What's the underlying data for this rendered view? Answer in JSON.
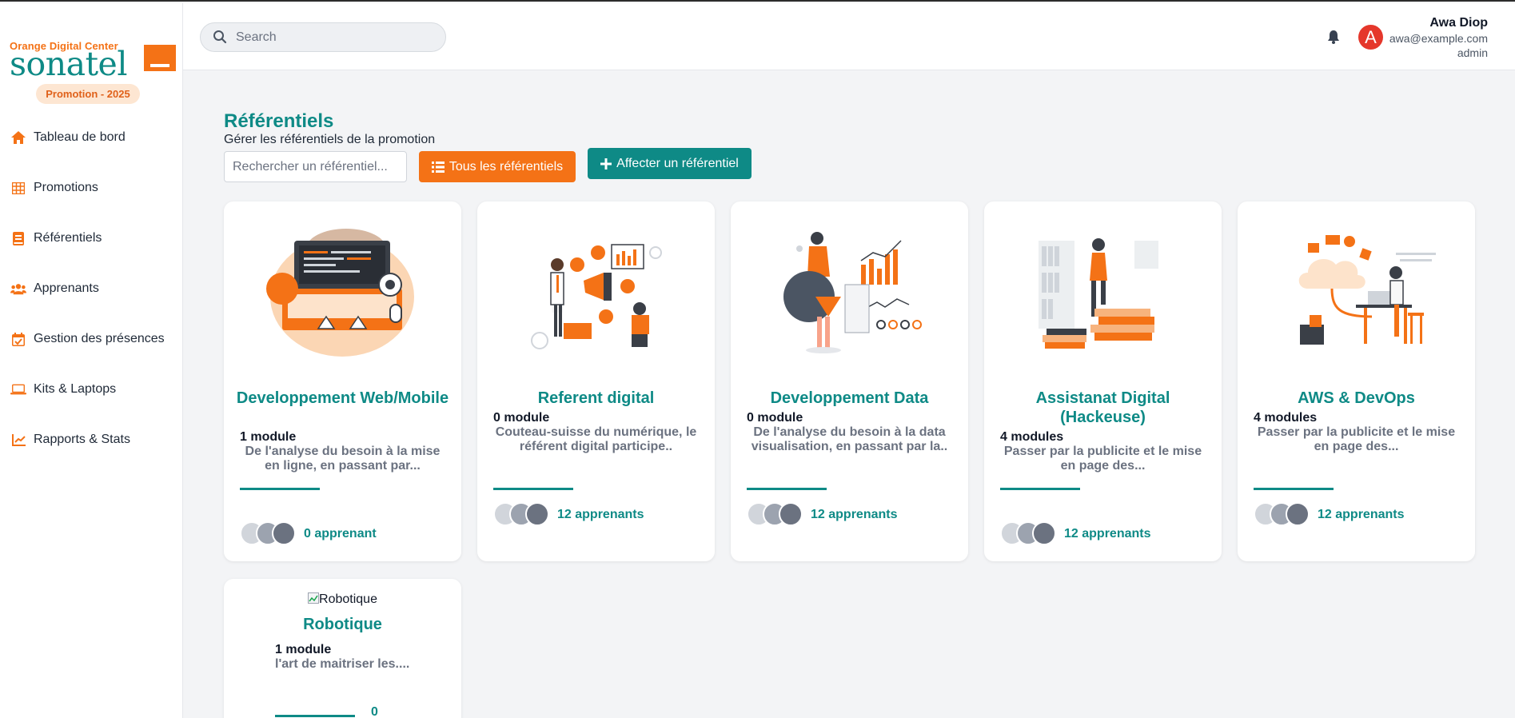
{
  "sidebar": {
    "logo_top": "Orange Digital Center",
    "logo_brand": "sonatel",
    "promotion_badge": "Promotion - 2025",
    "items": [
      {
        "label": "Tableau de bord",
        "icon": "home-icon"
      },
      {
        "label": "Promotions",
        "icon": "grid-icon"
      },
      {
        "label": "Référentiels",
        "icon": "book-icon"
      },
      {
        "label": "Apprenants",
        "icon": "users-icon"
      },
      {
        "label": "Gestion des présences",
        "icon": "calendar-check-icon"
      },
      {
        "label": "Kits & Laptops",
        "icon": "laptop-icon"
      },
      {
        "label": "Rapports & Stats",
        "icon": "chart-icon"
      }
    ]
  },
  "header": {
    "search_placeholder": "Search",
    "user": {
      "name": "Awa Diop",
      "email": "awa@example.com",
      "role": "admin",
      "avatar_letter": "A"
    }
  },
  "main": {
    "title": "Référentiels",
    "subtitle": "Gérer les référentiels de la promotion",
    "search_placeholder": "Rechercher un référentiel...",
    "btn_all": "Tous les référentiels",
    "btn_assign": "Affecter un référentiel",
    "cards": [
      {
        "title": "Developpement Web/Mobile",
        "modules": "1 module",
        "description": "De l'analyse du besoin à la mise en ligne, en passant par...",
        "count": "0 apprenant"
      },
      {
        "title": "Referent digital",
        "modules": "0 module",
        "description": "Couteau-suisse du numérique, le référent digital participe..",
        "count": "12 apprenants"
      },
      {
        "title": "Developpement Data",
        "modules": "0 module",
        "description": "De l'analyse du besoin à la data visualisation, en passant par la..",
        "count": "12 apprenants"
      },
      {
        "title": "Assistanat Digital (Hackeuse)",
        "modules": "4 modules",
        "description": "Passer par la publicite et le mise en page des...",
        "count": "12 apprenants"
      },
      {
        "title": "AWS & DevOps",
        "modules": "4 modules",
        "description": "Passer par la publicite et le mise en page des...",
        "count": "12 apprenants"
      },
      {
        "title": "Robotique",
        "image_alt": "Robotique",
        "modules": "1 module",
        "description": "l'art de maitriser les....",
        "count": "0"
      }
    ]
  },
  "colors": {
    "teal": "#0e8a86",
    "orange": "#f47216",
    "avatar_red": "#e5372b"
  }
}
